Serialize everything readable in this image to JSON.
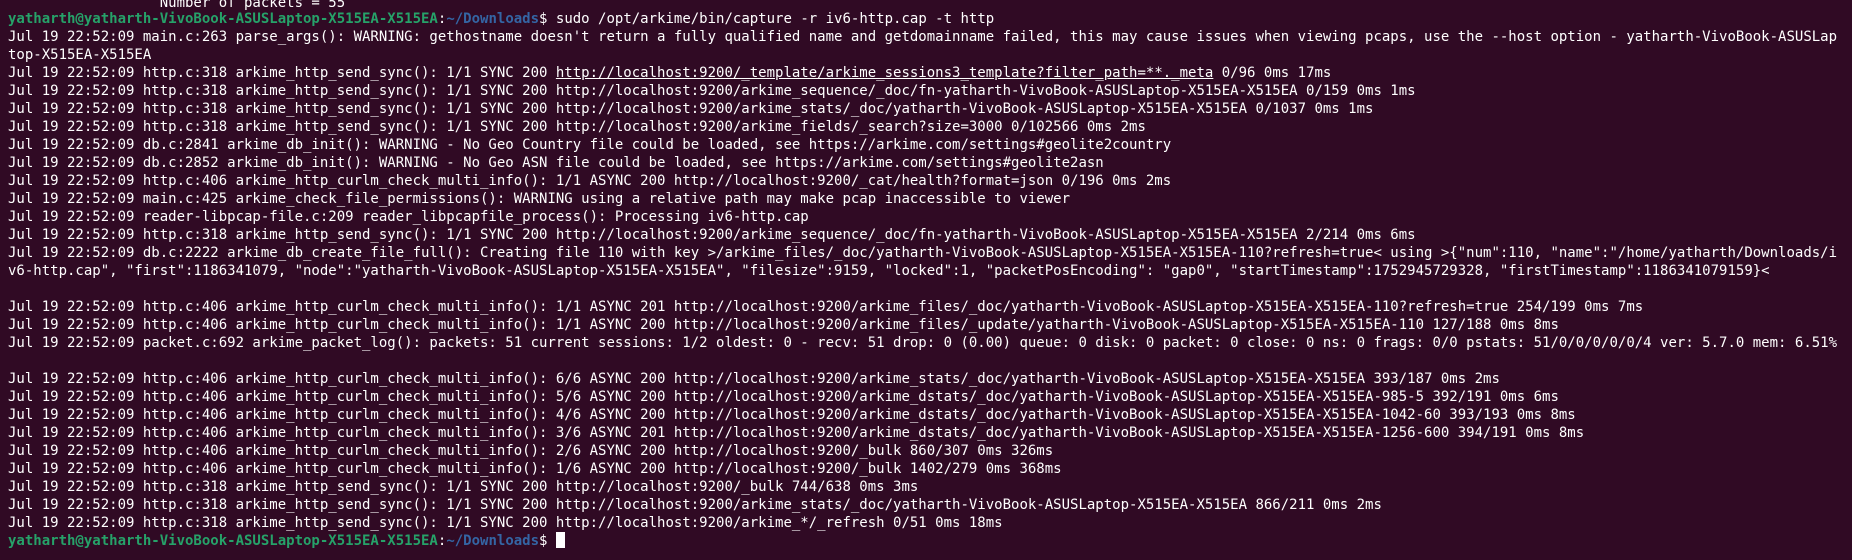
{
  "terminal": {
    "partial_top": "                  Number of packets = 55",
    "prompt": {
      "user_host": "yatharth@yatharth-VivoBook-ASUSLaptop-X515EA-X515EA",
      "sep": ":",
      "cwd": "~/Downloads",
      "dollar": "$ ",
      "command": "sudo /opt/arkime/bin/capture -r iv6-http.cap -t http"
    },
    "lines": [
      "Jul 19 22:52:09 main.c:263 parse_args(): WARNING: gethostname doesn't return a fully qualified name and getdomainname failed, this may cause issues when viewing pcaps, use the --host option - yatharth-VivoBook-ASUSLaptop-X515EA-X515EA",
      "Jul 19 22:52:09 http.c:318 arkime_http_send_sync(): 1/1 SYNC 200 ",
      "Jul 19 22:52:09 http.c:318 arkime_http_send_sync(): 1/1 SYNC 200 http://localhost:9200/arkime_sequence/_doc/fn-yatharth-VivoBook-ASUSLaptop-X515EA-X515EA 0/159 0ms 1ms",
      "Jul 19 22:52:09 http.c:318 arkime_http_send_sync(): 1/1 SYNC 200 http://localhost:9200/arkime_stats/_doc/yatharth-VivoBook-ASUSLaptop-X515EA-X515EA 0/1037 0ms 1ms",
      "Jul 19 22:52:09 http.c:318 arkime_http_send_sync(): 1/1 SYNC 200 http://localhost:9200/arkime_fields/_search?size=3000 0/102566 0ms 2ms",
      "Jul 19 22:52:09 db.c:2841 arkime_db_init(): WARNING - No Geo Country file could be loaded, see https://arkime.com/settings#geolite2country",
      "Jul 19 22:52:09 db.c:2852 arkime_db_init(): WARNING - No Geo ASN file could be loaded, see https://arkime.com/settings#geolite2asn",
      "Jul 19 22:52:09 http.c:406 arkime_http_curlm_check_multi_info(): 1/1 ASYNC 200 http://localhost:9200/_cat/health?format=json 0/196 0ms 2ms",
      "Jul 19 22:52:09 main.c:425 arkime_check_file_permissions(): WARNING using a relative path may make pcap inaccessible to viewer",
      "Jul 19 22:52:09 reader-libpcap-file.c:209 reader_libpcapfile_process(): Processing iv6-http.cap",
      "Jul 19 22:52:09 http.c:318 arkime_http_send_sync(): 1/1 SYNC 200 http://localhost:9200/arkime_sequence/_doc/fn-yatharth-VivoBook-ASUSLaptop-X515EA-X515EA 2/214 0ms 6ms",
      "Jul 19 22:52:09 db.c:2222 arkime_db_create_file_full(): Creating file 110 with key >/arkime_files/_doc/yatharth-VivoBook-ASUSLaptop-X515EA-X515EA-110?refresh=true< using >{\"num\":110, \"name\":\"/home/yatharth/Downloads/iv6-http.cap\", \"first\":1186341079, \"node\":\"yatharth-VivoBook-ASUSLaptop-X515EA-X515EA\", \"filesize\":9159, \"locked\":1, \"packetPosEncoding\": \"gap0\", \"startTimestamp\":1752945729328, \"firstTimestamp\":1186341079159}<",
      "Jul 19 22:52:09 http.c:406 arkime_http_curlm_check_multi_info(): 1/1 ASYNC 201 http://localhost:9200/arkime_files/_doc/yatharth-VivoBook-ASUSLaptop-X515EA-X515EA-110?refresh=true 254/199 0ms 7ms",
      "Jul 19 22:52:09 http.c:406 arkime_http_curlm_check_multi_info(): 1/1 ASYNC 200 http://localhost:9200/arkime_files/_update/yatharth-VivoBook-ASUSLaptop-X515EA-X515EA-110 127/188 0ms 8ms",
      "Jul 19 22:52:09 packet.c:692 arkime_packet_log(): packets: 51 current sessions: 1/2 oldest: 0 - recv: 51 drop: 0 (0.00) queue: 0 disk: 0 packet: 0 close: 0 ns: 0 frags: 0/0 pstats: 51/0/0/0/0/0/4 ver: 5.7.0 mem: 6.51%",
      "Jul 19 22:52:09 http.c:406 arkime_http_curlm_check_multi_info(): 6/6 ASYNC 200 http://localhost:9200/arkime_stats/_doc/yatharth-VivoBook-ASUSLaptop-X515EA-X515EA 393/187 0ms 2ms",
      "Jul 19 22:52:09 http.c:406 arkime_http_curlm_check_multi_info(): 5/6 ASYNC 200 http://localhost:9200/arkime_dstats/_doc/yatharth-VivoBook-ASUSLaptop-X515EA-X515EA-985-5 392/191 0ms 6ms",
      "Jul 19 22:52:09 http.c:406 arkime_http_curlm_check_multi_info(): 4/6 ASYNC 200 http://localhost:9200/arkime_dstats/_doc/yatharth-VivoBook-ASUSLaptop-X515EA-X515EA-1042-60 393/193 0ms 8ms",
      "Jul 19 22:52:09 http.c:406 arkime_http_curlm_check_multi_info(): 3/6 ASYNC 201 http://localhost:9200/arkime_dstats/_doc/yatharth-VivoBook-ASUSLaptop-X515EA-X515EA-1256-600 394/191 0ms 8ms",
      "Jul 19 22:52:09 http.c:406 arkime_http_curlm_check_multi_info(): 2/6 ASYNC 200 http://localhost:9200/_bulk 860/307 0ms 326ms",
      "Jul 19 22:52:09 http.c:406 arkime_http_curlm_check_multi_info(): 1/6 ASYNC 200 http://localhost:9200/_bulk 1402/279 0ms 368ms",
      "Jul 19 22:52:09 http.c:318 arkime_http_send_sync(): 1/1 SYNC 200 http://localhost:9200/_bulk 744/638 0ms 3ms",
      "Jul 19 22:52:09 http.c:318 arkime_http_send_sync(): 1/1 SYNC 200 http://localhost:9200/arkime_stats/_doc/yatharth-VivoBook-ASUSLaptop-X515EA-X515EA 866/211 0ms 2ms",
      "Jul 19 22:52:09 http.c:318 arkime_http_send_sync(): 1/1 SYNC 200 http://localhost:9200/arkime_*/_refresh 0/51 0ms 18ms"
    ],
    "template_url": "http://localhost:9200/_template/arkime_sessions3_template?filter_path=**._meta",
    "template_tail": " 0/96 0ms 17ms",
    "colors": {
      "background": "#300a24",
      "text": "#ffffff",
      "prompt_user": "#26a269",
      "prompt_path": "#3465a4"
    }
  }
}
